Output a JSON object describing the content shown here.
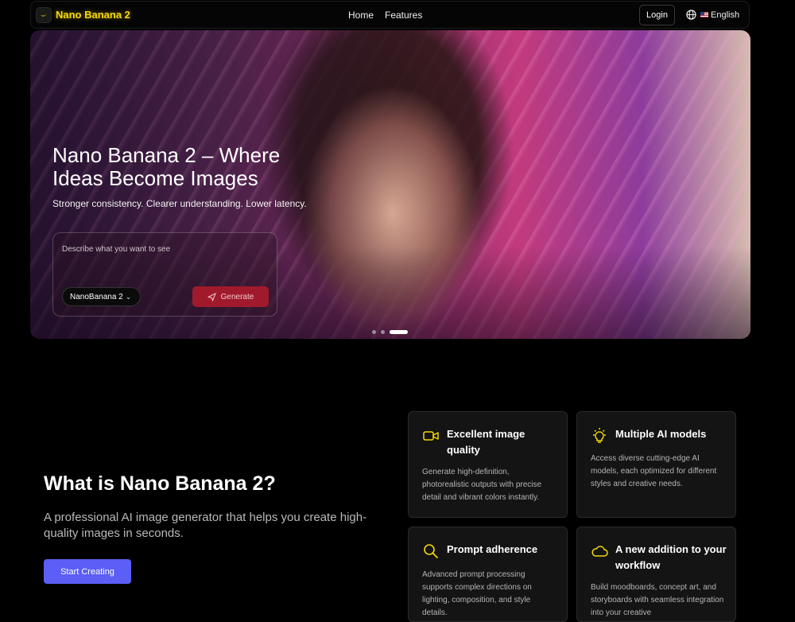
{
  "nav": {
    "brand": "Nano Banana 2",
    "links": [
      "Home",
      "Features"
    ],
    "login": "Login",
    "language": "English"
  },
  "hero": {
    "title": "Nano Banana 2 – Where Ideas Become Images",
    "subtitle": "Stronger consistency. Clearer understanding. Lower latency.",
    "prompt_placeholder": "Describe what you want to see",
    "model": "NanoBanana 2",
    "generate": "Generate",
    "slides": 3,
    "active_slide": 3
  },
  "about": {
    "title": "What is Nano Banana 2?",
    "description": "A professional AI image generator that helps you create high-quality images in seconds.",
    "cta": "Start Creating"
  },
  "features": [
    {
      "title": "Excellent image quality",
      "desc": "Generate high-definition, photorealistic outputs with precise detail and vibrant colors instantly.",
      "icon": "video-camera-icon"
    },
    {
      "title": "Multiple AI models",
      "desc": "Access diverse cutting-edge AI models, each optimized for different styles and creative needs.",
      "icon": "lightbulb-icon"
    },
    {
      "title": "Prompt adherence",
      "desc": "Advanced prompt processing supports complex directions on lighting, composition, and style details.",
      "icon": "search-icon"
    },
    {
      "title": "A new addition to your workflow",
      "desc": "Build moodboards, concept art, and storyboards with seamless integration into your creative",
      "icon": "cloud-icon"
    }
  ],
  "colors": {
    "accent": "#f5d90a",
    "cta": "#5b5ff5",
    "generate": "#a11a2c"
  }
}
